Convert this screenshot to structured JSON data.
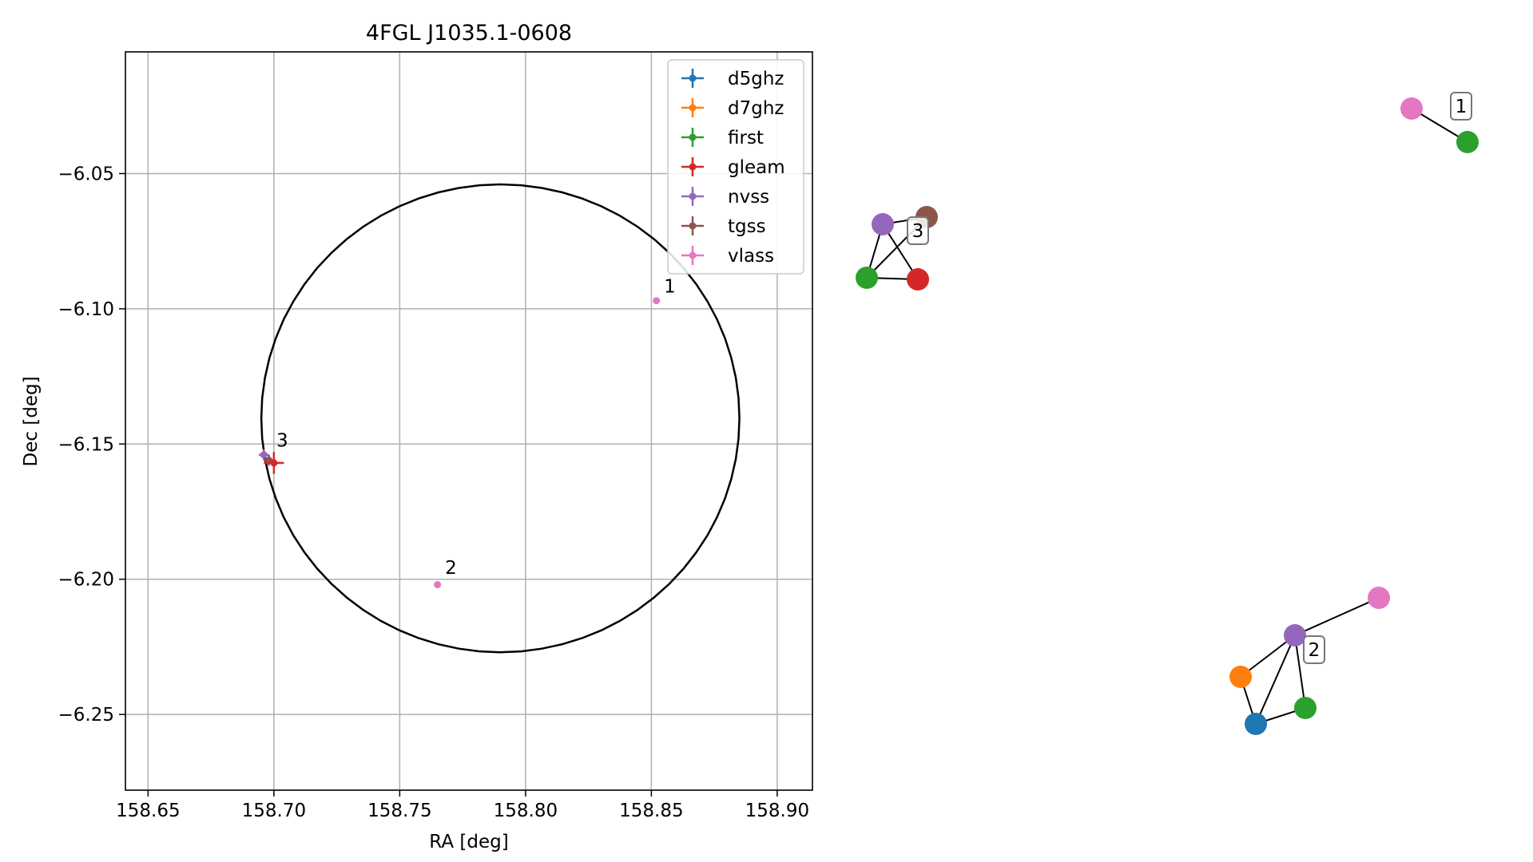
{
  "chart_data": [
    {
      "type": "scatter",
      "title": "4FGL J1035.1-0608",
      "xlabel": "RA [deg]",
      "ylabel": "Dec [deg]",
      "xlim": [
        158.641,
        158.914
      ],
      "ylim": [
        -6.278,
        -6.005
      ],
      "xticks": [
        158.65,
        158.7,
        158.75,
        158.8,
        158.85,
        158.9
      ],
      "xtick_labels": [
        "158.65",
        "158.70",
        "158.75",
        "158.80",
        "158.85",
        "158.90"
      ],
      "yticks": [
        -6.05,
        -6.1,
        -6.15,
        -6.2,
        -6.25
      ],
      "ytick_labels": [
        "−6.05",
        "−6.10",
        "−6.15",
        "−6.20",
        "−6.25"
      ],
      "grid": true,
      "legend_position": "top-right",
      "series": [
        {
          "name": "d5ghz",
          "color": "#1f77b4"
        },
        {
          "name": "d7ghz",
          "color": "#ff7f0e"
        },
        {
          "name": "first",
          "color": "#2ca02c"
        },
        {
          "name": "gleam",
          "color": "#d62728"
        },
        {
          "name": "nvss",
          "color": "#9467bd"
        },
        {
          "name": "tgss",
          "color": "#8c564b"
        },
        {
          "name": "vlass",
          "color": "#e377c2"
        }
      ],
      "points": [
        {
          "series": "vlass",
          "x": 158.852,
          "y": -6.097,
          "xerr": 0.001,
          "yerr": 0.001
        },
        {
          "series": "vlass",
          "x": 158.765,
          "y": -6.202,
          "xerr": 0.001,
          "yerr": 0.001
        },
        {
          "series": "nvss",
          "x": 158.696,
          "y": -6.154,
          "xerr": 0.002,
          "yerr": 0.002
        },
        {
          "series": "tgss",
          "x": 158.698,
          "y": -6.156,
          "xerr": 0.002,
          "yerr": 0.002
        },
        {
          "series": "gleam",
          "x": 158.7,
          "y": -6.157,
          "xerr": 0.004,
          "yerr": 0.004
        }
      ],
      "annotations": [
        {
          "text": "1",
          "x": 158.855,
          "y": -6.094
        },
        {
          "text": "2",
          "x": 158.768,
          "y": -6.198
        },
        {
          "text": "3",
          "x": 158.701,
          "y": -6.151
        }
      ],
      "ellipse": {
        "center": [
          158.79,
          -6.1405
        ],
        "semi_axis_x": 0.095,
        "semi_axis_y": 0.0865,
        "color": "#000000"
      }
    },
    {
      "type": "network",
      "groups": [
        {
          "label": "1",
          "nodes": [
            {
              "id": "a",
              "series": "vlass"
            },
            {
              "id": "b",
              "series": "first"
            }
          ],
          "edges": [
            [
              "a",
              "b"
            ]
          ]
        },
        {
          "label": "3",
          "nodes": [
            {
              "id": "n",
              "series": "nvss"
            },
            {
              "id": "t",
              "series": "tgss"
            },
            {
              "id": "f",
              "series": "first"
            },
            {
              "id": "g",
              "series": "gleam"
            }
          ],
          "edges": [
            [
              "n",
              "t"
            ],
            [
              "n",
              "f"
            ],
            [
              "n",
              "g"
            ],
            [
              "f",
              "g"
            ],
            [
              "f",
              "t"
            ]
          ]
        },
        {
          "label": "2",
          "nodes": [
            {
              "id": "n",
              "series": "nvss"
            },
            {
              "id": "v",
              "series": "vlass"
            },
            {
              "id": "d7",
              "series": "d7ghz"
            },
            {
              "id": "d5",
              "series": "d5ghz"
            },
            {
              "id": "f",
              "series": "first"
            }
          ],
          "edges": [
            [
              "n",
              "v"
            ],
            [
              "n",
              "d7"
            ],
            [
              "n",
              "d5"
            ],
            [
              "n",
              "f"
            ],
            [
              "d7",
              "d5"
            ],
            [
              "d5",
              "f"
            ]
          ]
        }
      ]
    }
  ]
}
